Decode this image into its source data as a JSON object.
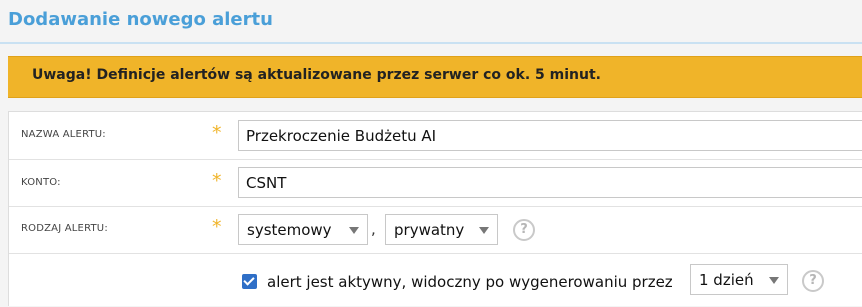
{
  "page": {
    "title": "Dodawanie nowego alertu"
  },
  "warning": {
    "text": "Uwaga! Definicje alertów są aktualizowane przez serwer co ok. 5 minut."
  },
  "form": {
    "alert_name": {
      "label": "NAZWA ALERTU:",
      "value": "Przekroczenie Budżetu AI"
    },
    "account": {
      "label": "KONTO:",
      "value": "CSNT"
    },
    "alert_type": {
      "label": "RODZAJ ALERTU:",
      "type_select": "systemowy",
      "separator": ",",
      "visibility_select": "prywatny",
      "help": "?"
    },
    "active": {
      "checked": true,
      "label": "alert jest aktywny, widoczny po wygenerowaniu przez",
      "duration_select": "1 dzień",
      "help": "?"
    },
    "required_mark": "*"
  },
  "colors": {
    "accent": "#4a9fd8",
    "warning_bg": "#f0b429",
    "checkbox": "#2f6fc7"
  }
}
